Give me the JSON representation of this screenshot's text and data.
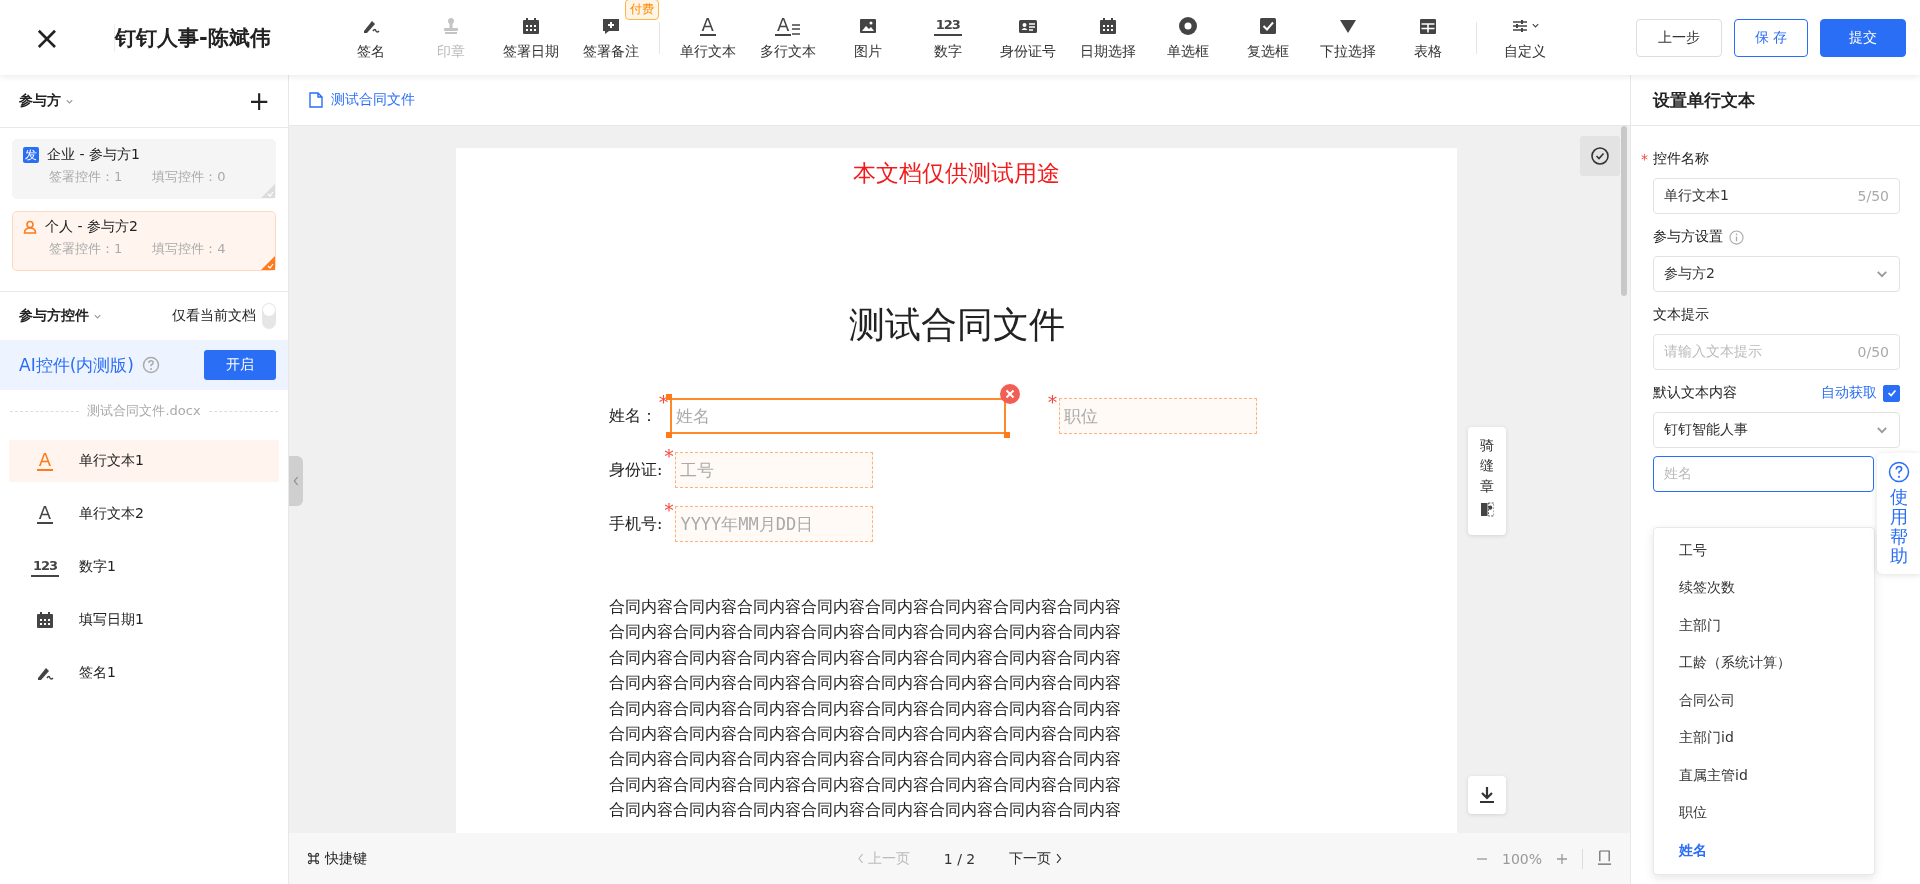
{
  "header": {
    "close": "×",
    "title": "钉钉人事-陈斌伟"
  },
  "toolbar": {
    "groups": [
      [
        {
          "label": "签名",
          "disabled": false
        },
        {
          "label": "印章",
          "disabled": true
        },
        {
          "label": "签署日期",
          "disabled": false
        },
        {
          "label": "签署备注",
          "disabled": false,
          "badge": "付费"
        }
      ],
      [
        {
          "label": "单行文本",
          "disabled": false,
          "glyph": "A"
        },
        {
          "label": "多行文本",
          "disabled": false,
          "glyph": "A"
        },
        {
          "label": "图片",
          "disabled": false
        },
        {
          "label": "数字",
          "disabled": false,
          "glyph": "123"
        },
        {
          "label": "身份证号",
          "disabled": false
        },
        {
          "label": "日期选择",
          "disabled": false
        },
        {
          "label": "单选框",
          "disabled": false
        },
        {
          "label": "复选框",
          "disabled": false
        },
        {
          "label": "下拉选择",
          "disabled": false
        },
        {
          "label": "表格",
          "disabled": false
        }
      ],
      [
        {
          "label": "自定义",
          "disabled": false,
          "caret": true
        }
      ]
    ]
  },
  "actions": [
    {
      "label": "上一步",
      "kind": "default"
    },
    {
      "label": "保 存",
      "kind": "outline"
    },
    {
      "label": "提交",
      "kind": "primary"
    }
  ],
  "sidebar": {
    "parties_title": "参与方",
    "add": "+",
    "parties": [
      {
        "kind": "company",
        "badge": "发",
        "name": "企业 - 参与方1",
        "sign_count": "签署控件：1",
        "fill_count": "填写控件：0",
        "selected": false
      },
      {
        "kind": "person",
        "name": "个人 - 参与方2",
        "sign_count": "签署控件：1",
        "fill_count": "填写控件：4",
        "selected": true
      }
    ],
    "controls_title": "参与方控件",
    "only_current": {
      "label": "仅看当前文档",
      "on": false
    },
    "ai": {
      "label": "AI控件(内测版)",
      "button": "开启"
    },
    "file": "测试合同文件.docx",
    "controls": [
      {
        "name": "单行文本1",
        "glyph": "A",
        "selected": true
      },
      {
        "name": "单行文本2",
        "glyph": "A",
        "selected": false
      },
      {
        "name": "数字1",
        "glyph": "123",
        "selected": false
      },
      {
        "name": "填写日期1",
        "selected": false
      },
      {
        "name": "签名1",
        "selected": false
      }
    ]
  },
  "document": {
    "tab": "测试合同文件",
    "notice": "本文档仅供测试用途",
    "title": "测试合同文件",
    "form_rows": [
      {
        "fields": [
          {
            "label": "姓名：",
            "required_mark": "*",
            "placeholder": "姓名",
            "selected": true
          },
          {
            "required_mark": "*",
            "placeholder": "职位",
            "selected": false
          }
        ]
      },
      {
        "fields": [
          {
            "label": "身份证:",
            "required_mark": "*",
            "placeholder": "工号",
            "selected": false
          }
        ]
      },
      {
        "fields": [
          {
            "label": "手机号:",
            "required_mark": "*",
            "placeholder": "YYYY年MM月DD日",
            "selected": false
          }
        ]
      }
    ],
    "body_lines": [
      "合同内容合同内容合同内容合同内容合同内容合同内容合同内容合同内容",
      "合同内容合同内容合同内容合同内容合同内容合同内容合同内容合同内容",
      "合同内容合同内容合同内容合同内容合同内容合同内容合同内容合同内容",
      "合同内容合同内容合同内容合同内容合同内容合同内容合同内容合同内容",
      "合同内容合同内容合同内容合同内容合同内容合同内容合同内容合同内容",
      "合同内容合同内容合同内容合同内容合同内容合同内容合同内容合同内容",
      "合同内容合同内容合同内容合同内容合同内容合同内容合同内容合同内容",
      "合同内容合同内容合同内容合同内容合同内容合同内容合同内容合同内容",
      "合同内容合同内容合同内容合同内容合同内容合同内容合同内容合同内容"
    ],
    "seal_tab": "骑缝章"
  },
  "footer": {
    "shortcuts": "快捷键",
    "prev": "上一页",
    "prev_disabled": true,
    "page": "1 / 2",
    "next": "下一页",
    "zoom": "100%"
  },
  "panel": {
    "title": "设置单行文本",
    "name_field": {
      "label": "控件名称",
      "required_mark": "*",
      "value": "单行文本1",
      "count": "5/50"
    },
    "party_field": {
      "label": "参与方设置",
      "value": "参与方2"
    },
    "hint_field": {
      "label": "文本提示",
      "placeholder": "请输入文本提示",
      "count": "0/50"
    },
    "default_field": {
      "label": "默认文本内容",
      "auto_label": "自动获取",
      "auto_checked": true,
      "source": "钉钉智能人事",
      "placeholder": "姓名"
    },
    "options": [
      {
        "label": "工号",
        "selected": false
      },
      {
        "label": "续签次数",
        "selected": false
      },
      {
        "label": "主部门",
        "selected": false
      },
      {
        "label": "工龄（系统计算）",
        "selected": false
      },
      {
        "label": "合同公司",
        "selected": false
      },
      {
        "label": "主部门id",
        "selected": false
      },
      {
        "label": "直属主管id",
        "selected": false
      },
      {
        "label": "职位",
        "selected": false
      },
      {
        "label": "姓名",
        "selected": true
      }
    ],
    "help": "使用帮助"
  }
}
